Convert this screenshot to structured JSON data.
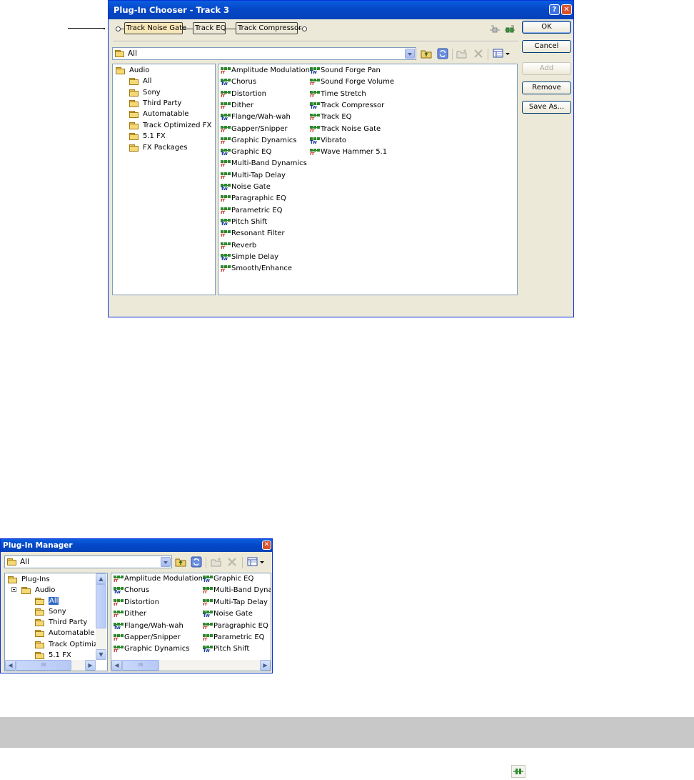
{
  "chooser": {
    "title": "Plug-In Chooser - Track 3",
    "help_btn": "?",
    "close_btn": "✕",
    "chain": [
      "Track Noise Gate",
      "Track EQ",
      "Track Compressor"
    ],
    "combo_value": "All",
    "tree": [
      "Audio",
      "All",
      "Sony",
      "Third Party",
      "Automatable",
      "Track Optimized FX",
      "5.1 FX",
      "FX Packages"
    ],
    "plugins_col1": [
      "Amplitude Modulation",
      "Chorus",
      "Distortion",
      "Dither",
      "Flange/Wah-wah",
      "Gapper/Snipper",
      "Graphic Dynamics",
      "Graphic EQ",
      "Multi-Band Dynamics",
      "Multi-Tap Delay",
      "Noise Gate",
      "Paragraphic EQ",
      "Parametric EQ",
      "Pitch Shift",
      "Resonant Filter",
      "Reverb",
      "Simple Delay",
      "Smooth/Enhance"
    ],
    "plugins_col2": [
      "Sound Forge Pan",
      "Sound Forge Volume",
      "Time Stretch",
      "Track Compressor",
      "Track EQ",
      "Track Noise Gate",
      "Vibrato",
      "Wave Hammer 5.1"
    ],
    "buttons": {
      "ok": "OK",
      "cancel": "Cancel",
      "add": "Add",
      "remove": "Remove",
      "save_as": "Save As..."
    }
  },
  "manager": {
    "title": "Plug-In Manager",
    "close_btn": "✕",
    "combo_value": "All",
    "tree": [
      "Plug-Ins",
      "Audio",
      "All",
      "Sony",
      "Third Party",
      "Automatable",
      "Track Optimize",
      "5.1 FX"
    ],
    "plugins_col1": [
      "Amplitude Modulation",
      "Chorus",
      "Distortion",
      "Dither",
      "Flange/Wah-wah",
      "Gapper/Snipper",
      "Graphic Dynamics"
    ],
    "plugins_col2": [
      "Graphic EQ",
      "Multi-Band Dynan",
      "Multi-Tap Delay",
      "Noise Gate",
      "Paragraphic EQ",
      "Parametric EQ",
      "Pitch Shift"
    ],
    "scroll_grip": "III"
  }
}
